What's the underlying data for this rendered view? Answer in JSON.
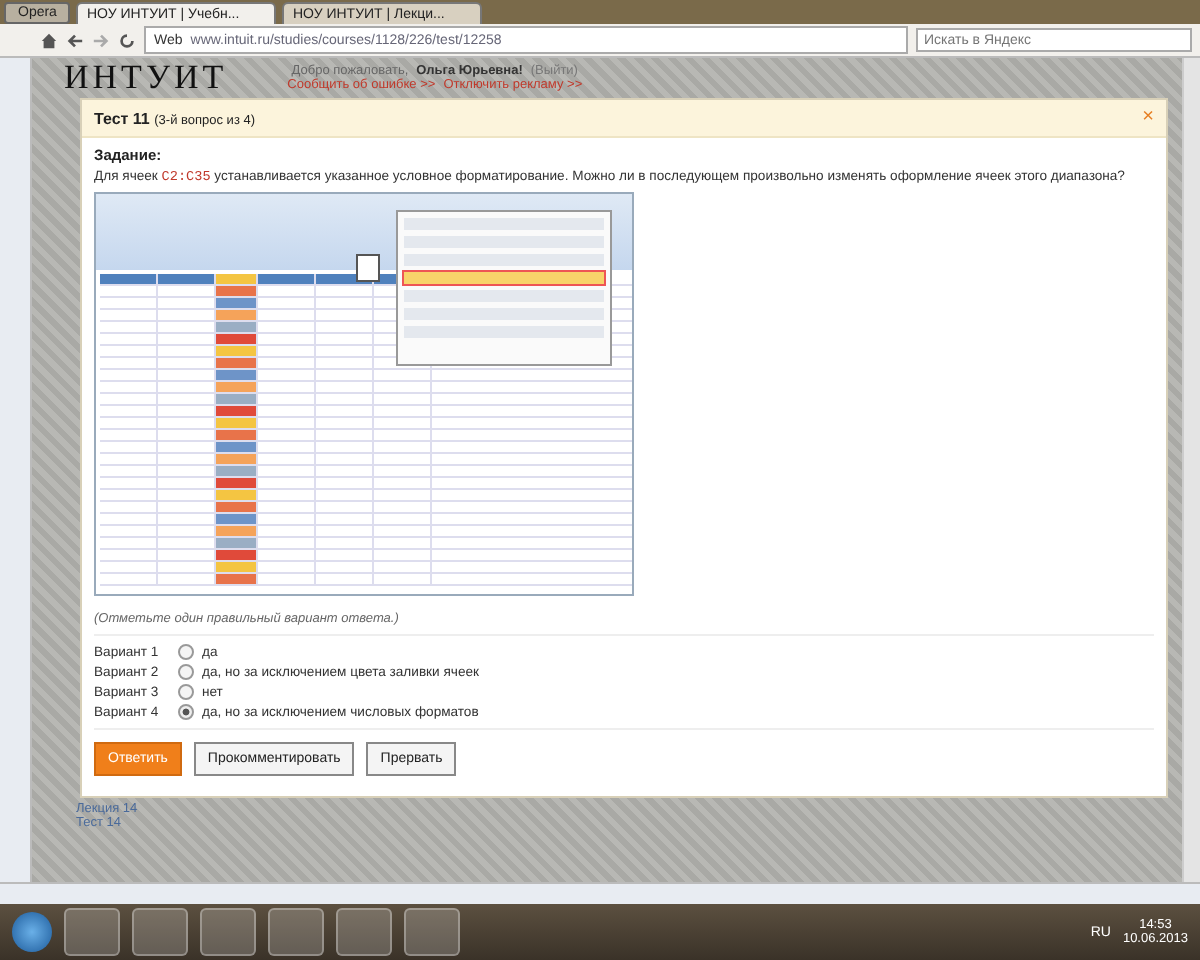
{
  "browser": {
    "menu_label": "Opera",
    "tabs": [
      {
        "title": "НОУ ИНТУИТ | Учебн...",
        "selected": true
      },
      {
        "title": "НОУ ИНТУИТ | Лекци...",
        "selected": false
      }
    ],
    "address_label": "Web",
    "url": "www.intuit.ru/studies/courses/1128/226/test/12258",
    "search_placeholder": "Искать в Яндекс"
  },
  "site": {
    "logo": "ИНТУИТ",
    "welcome": "Добро пожаловать,",
    "user": "Ольга Юрьевна!",
    "logout": "(Выйти)",
    "links": [
      "Сообщить об ошибке >>",
      "Отключить рекламу >>"
    ],
    "sidebar_links": [
      "Лекция 14",
      "Тест 14"
    ]
  },
  "dialog": {
    "title": "Тест 11",
    "subtitle": "(3-й вопрос из 4)",
    "close": "×",
    "task_heading": "Задание:",
    "question_before": "Для ячеек",
    "range": "C2:C35",
    "question_after": "устанавливается указанное условное форматирование. Можно ли в последующем произвольно изменять оформление ячеек этого диапазона?",
    "hint": "(Отметьте один правильный вариант ответа.)",
    "options": [
      {
        "label": "Вариант 1",
        "text": "да",
        "selected": false
      },
      {
        "label": "Вариант 2",
        "text": "да, но за исключением цвета заливки ячеек",
        "selected": false
      },
      {
        "label": "Вариант 3",
        "text": "нет",
        "selected": false
      },
      {
        "label": "Вариант 4",
        "text": "да, но за исключением числовых форматов",
        "selected": true
      }
    ],
    "buttons": [
      {
        "label": "Ответить",
        "kind": "primary"
      },
      {
        "label": "Прокомментировать",
        "kind": "normal"
      },
      {
        "label": "Прервать",
        "kind": "normal"
      }
    ]
  },
  "taskbar": {
    "language": "RU",
    "time": "14:53",
    "date": "10.06.2013"
  }
}
